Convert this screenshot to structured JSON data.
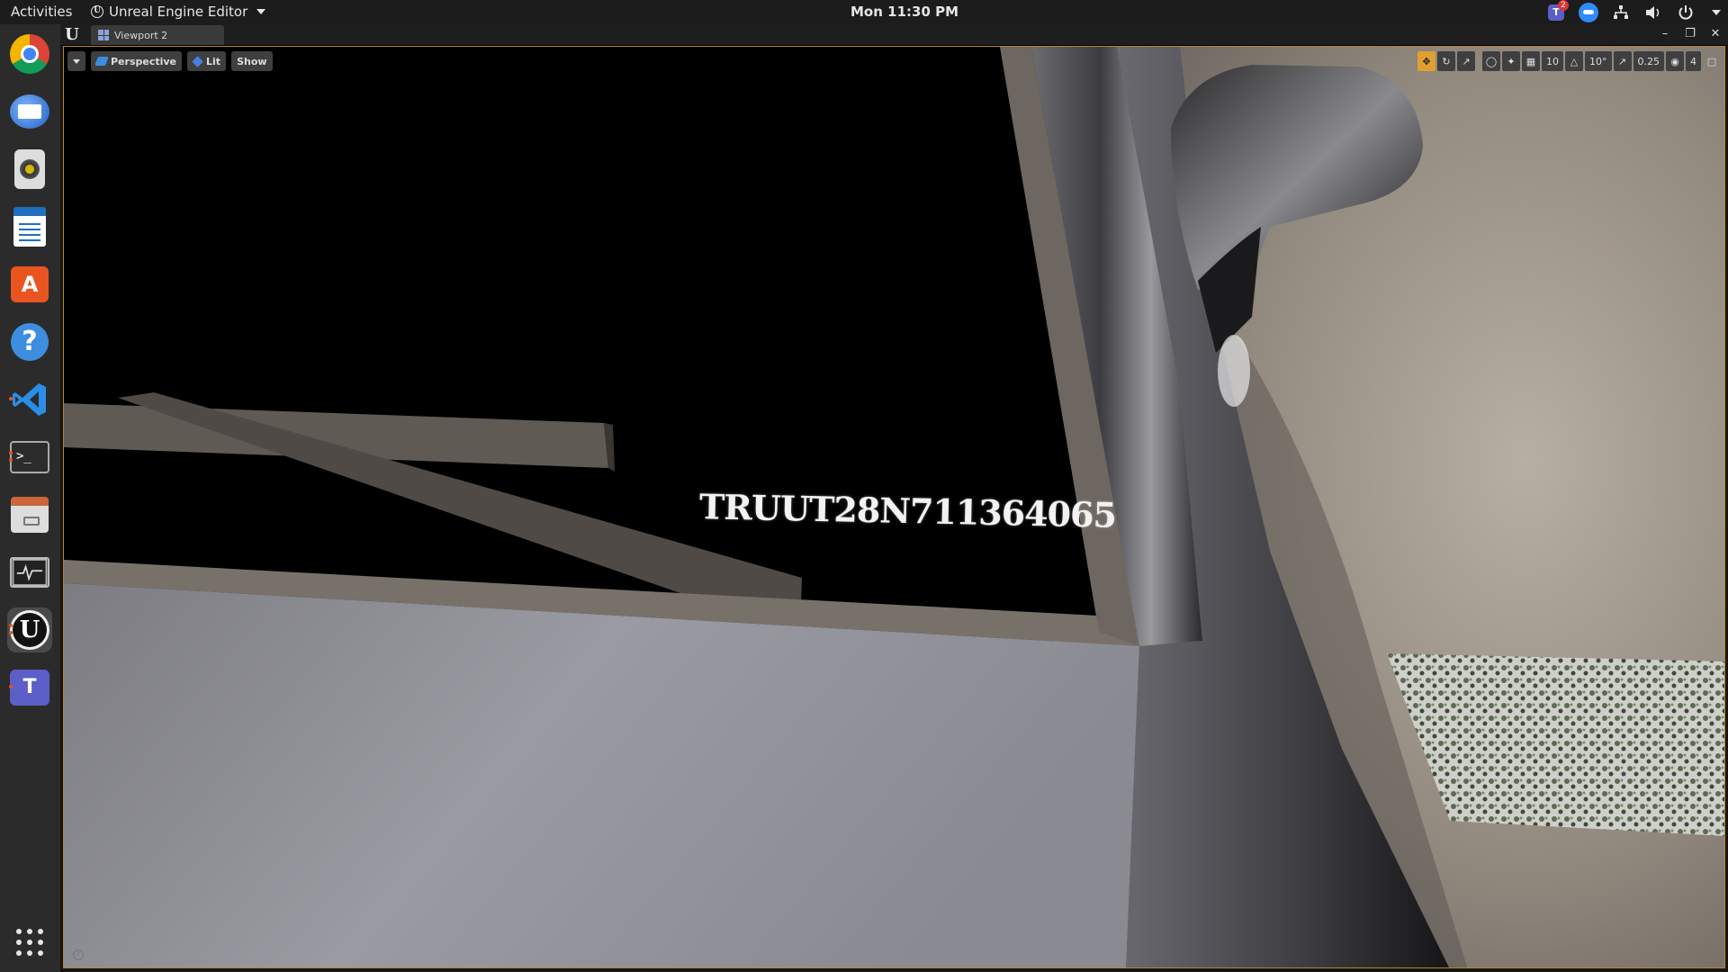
{
  "topbar": {
    "activities": "Activities",
    "app_name": "Unreal Engine Editor",
    "clock": "Mon 11:30 PM",
    "teams_badge": "2"
  },
  "dock": {
    "items": [
      {
        "name": "chrome"
      },
      {
        "name": "thunderbird"
      },
      {
        "name": "rhythmbox"
      },
      {
        "name": "libreoffice-writer"
      },
      {
        "name": "ubuntu-software"
      },
      {
        "name": "help"
      },
      {
        "name": "vscode"
      },
      {
        "name": "terminal"
      },
      {
        "name": "files"
      },
      {
        "name": "system-monitor"
      },
      {
        "name": "unreal-engine"
      },
      {
        "name": "teams"
      }
    ],
    "show_apps_icon": "grid-icon"
  },
  "editor": {
    "tab_label": "Viewport 2",
    "viewport": {
      "view_mode": "Perspective",
      "lighting": "Lit",
      "show": "Show",
      "grid_snap": "10",
      "rotation_snap": "10°",
      "scale_snap": "0.25",
      "camera_speed": "4"
    },
    "scene_text": "TRUUT28N711364065"
  },
  "colors": {
    "accent": "#e95420",
    "viewport_border": "#b8862b",
    "active_tool": "#e0a030"
  }
}
